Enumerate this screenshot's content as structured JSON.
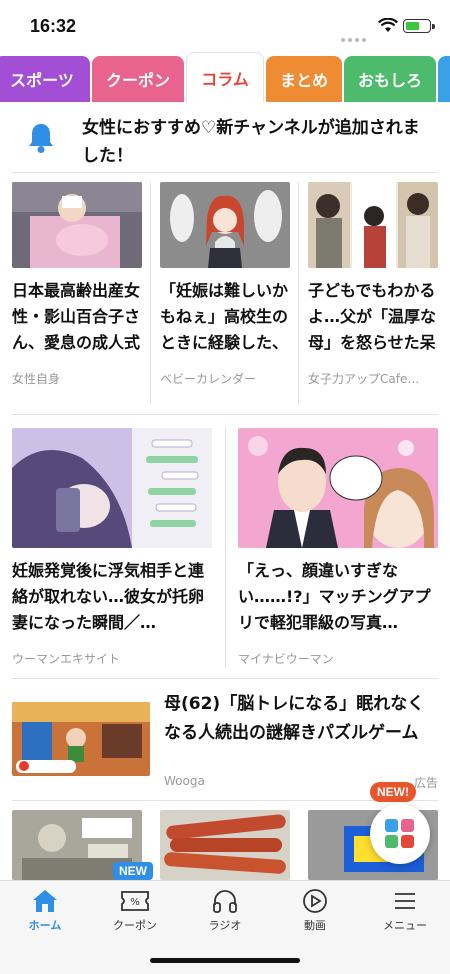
{
  "status": {
    "time": "16:32"
  },
  "tabs": [
    {
      "label": "スポーツ",
      "color": "#a24fd6"
    },
    {
      "label": "クーポン",
      "color": "#e8638e"
    },
    {
      "label": "コラム",
      "color": "#e3473a"
    },
    {
      "label": "まとめ",
      "color": "#ef8b33"
    },
    {
      "label": "おもしろ",
      "color": "#4dbb6b"
    }
  ],
  "notice": {
    "text": "女性におすすめ♡新チャンネルが追加されました！"
  },
  "articles_row1": [
    {
      "title": "日本最高齢出産女性・影山百合子さん、愛息の成人式を独占…",
      "source": "女性自身"
    },
    {
      "title": "「妊娠は難しいかもねぇ」高校生のときに経験した、ある出…",
      "source": "ベビーカレンダー"
    },
    {
      "title": "子どもでもわかるよ…父が「温厚な母」を怒らせた呆れた理…",
      "source": "女子力アップCafe…"
    }
  ],
  "articles_row2": [
    {
      "title": "妊娠発覚後に浮気相手と連絡が取れない…彼女が托卵妻になった瞬間／…",
      "source": "ウーマンエキサイト"
    },
    {
      "title": "「えっ、顔違いすぎない……!?」マッチングアプリで軽犯罪級の写真…",
      "source": "マイナビウーマン"
    }
  ],
  "ad": {
    "title": "母(62)「脳トレになる」眠れなくなる人続出の謎解きパズルゲーム",
    "source": "Wooga",
    "tag": "広告"
  },
  "fab": {
    "badge": "NEW!"
  },
  "nav": {
    "new_badge": "NEW",
    "items": [
      {
        "label": "ホーム"
      },
      {
        "label": "クーポン"
      },
      {
        "label": "ラジオ"
      },
      {
        "label": "動画"
      },
      {
        "label": "メニュー"
      }
    ]
  },
  "colors": {
    "accent": "#2f8ee5",
    "active_tab": "#e3473a"
  }
}
